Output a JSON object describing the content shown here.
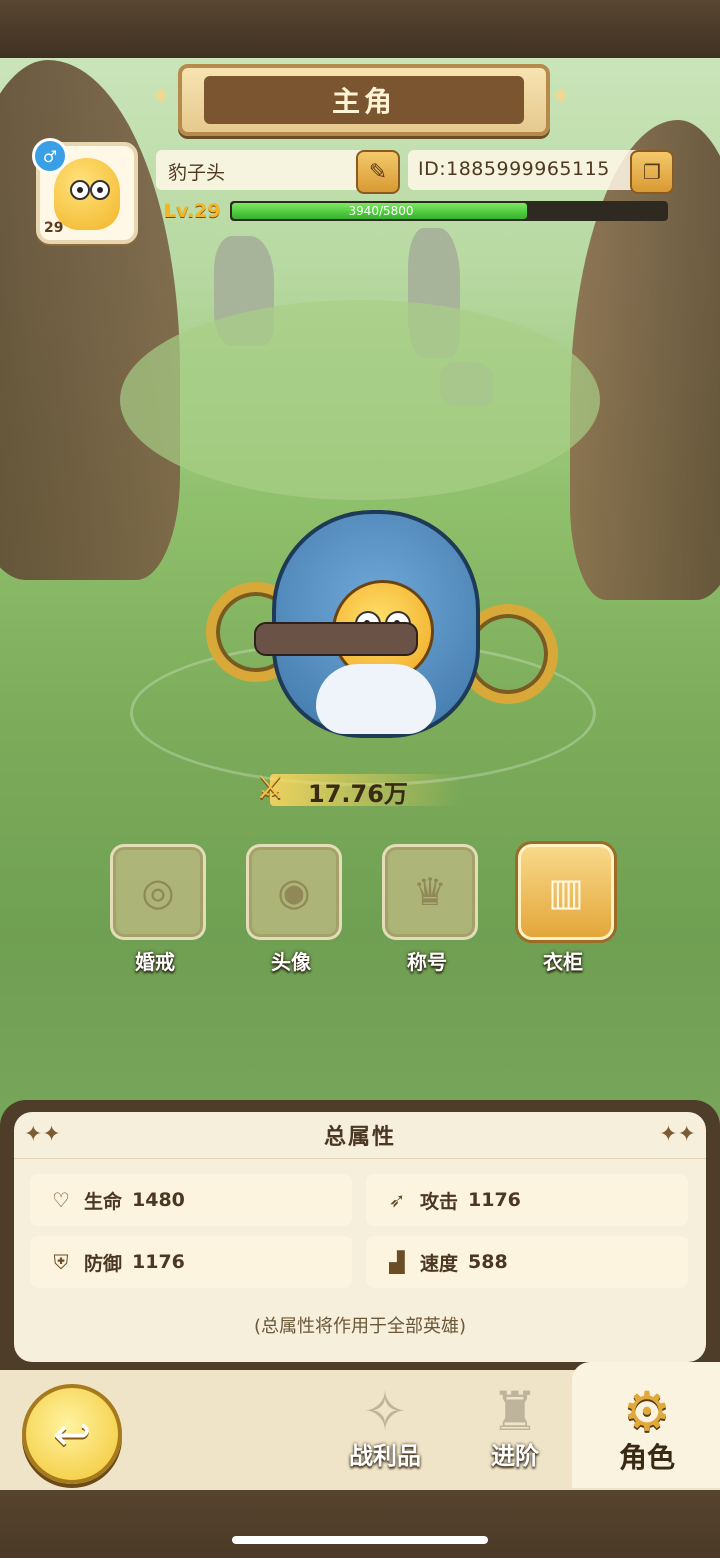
{
  "header": {
    "title": "主角"
  },
  "profile": {
    "gender_symbol": "♂",
    "avatar_level": "29",
    "name": "豹子头",
    "id_text": "ID:1885999965115",
    "level_text": "Lv.29",
    "xp_text": "3940/5800",
    "xp_current": 3940,
    "xp_max": 5800
  },
  "power": {
    "value": "17.76万"
  },
  "features": [
    {
      "label": "婚戒",
      "icon": "ring-icon",
      "active": false
    },
    {
      "label": "头像",
      "icon": "portrait-icon",
      "active": false
    },
    {
      "label": "称号",
      "icon": "crown-plaque-icon",
      "active": false
    },
    {
      "label": "衣柜",
      "icon": "wardrobe-icon",
      "active": true
    }
  ],
  "attributes": {
    "title": "总属性",
    "stats": [
      {
        "icon": "heart-icon",
        "name": "生命",
        "value": "1480"
      },
      {
        "icon": "wing-sword-icon",
        "name": "攻击",
        "value": "1176"
      },
      {
        "icon": "shield-icon",
        "name": "防御",
        "value": "1176"
      },
      {
        "icon": "boot-icon",
        "name": "速度",
        "value": "588"
      }
    ],
    "note": "(总属性将作用于全部英雄)"
  },
  "nav": {
    "items": [
      {
        "label": "战利品",
        "icon": "loot-icon",
        "active": false
      },
      {
        "label": "进阶",
        "icon": "advance-icon",
        "active": false
      },
      {
        "label": "角色",
        "icon": "character-icon",
        "active": true
      }
    ]
  },
  "colors": {
    "accent": "#f2b52a",
    "xp_fill": "#33b22a",
    "panel": "#f6efdc"
  }
}
